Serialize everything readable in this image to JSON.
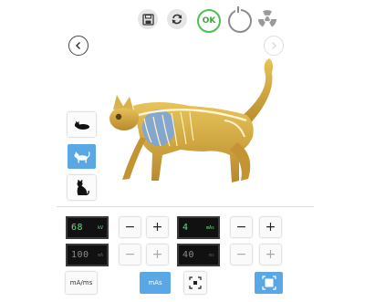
{
  "toolbar": {
    "ok_label": "OK",
    "icons": [
      "save-icon",
      "refresh-icon",
      "ok-icon",
      "power-icon",
      "radiation-icon"
    ]
  },
  "nav": {
    "back": "chevron-left-icon",
    "forward": "chevron-right-icon"
  },
  "views": [
    "lateral-lying",
    "lateral-standing",
    "sitting"
  ],
  "params": {
    "kv": {
      "value": "68",
      "unit": "kV"
    },
    "mas": {
      "value": "4",
      "unit": "mAs"
    },
    "ma": {
      "value": "100",
      "unit": "mA"
    },
    "ms": {
      "value": "40",
      "unit": "ms"
    }
  },
  "stepper": {
    "minus": "−",
    "plus": "+"
  },
  "bottom": {
    "mode_a": "mA/ms",
    "mode_b": "mAs"
  },
  "colors": {
    "accent": "#5aa7e6",
    "display_on": "#5ce27c",
    "ok_green": "#4fc04f"
  }
}
